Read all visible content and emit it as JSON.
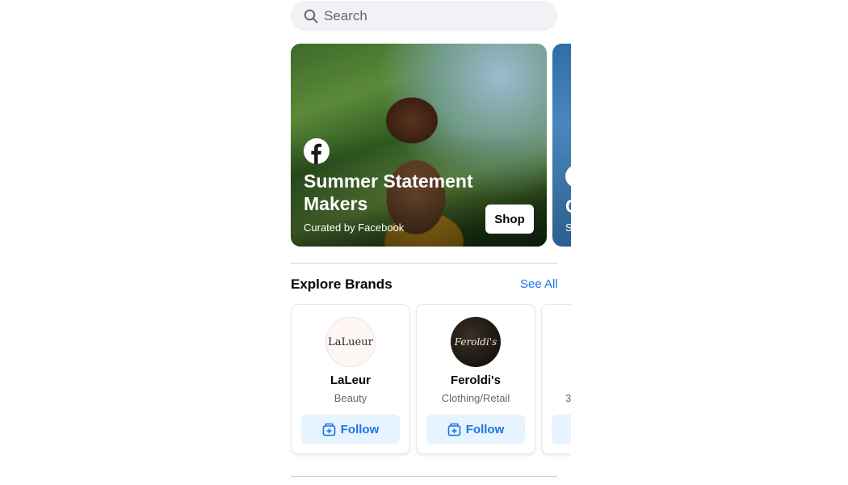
{
  "search": {
    "placeholder": "Search"
  },
  "hero": {
    "title": "Summer Statement Makers",
    "subtitle": "Curated by Facebook",
    "shop_label": "Shop",
    "logo_icon": "facebook-icon"
  },
  "hero_next": {
    "title_initial": "C",
    "subtitle_initial": "S"
  },
  "explore": {
    "title": "Explore Brands",
    "see_all": "See All"
  },
  "brands": [
    {
      "logo_text": "LaLueur",
      "name": "LaLeur",
      "category": "Beauty",
      "follow_label": "Follow"
    },
    {
      "logo_text": "Feroldi's",
      "name": "Feroldi's",
      "category": "Clothing/Retail",
      "follow_label": "Follow"
    },
    {
      "category_fragment": "3"
    }
  ],
  "colors": {
    "accent": "#1b74e4",
    "follow_bg": "#e7f3ff",
    "search_bg": "#f0f2f5"
  }
}
